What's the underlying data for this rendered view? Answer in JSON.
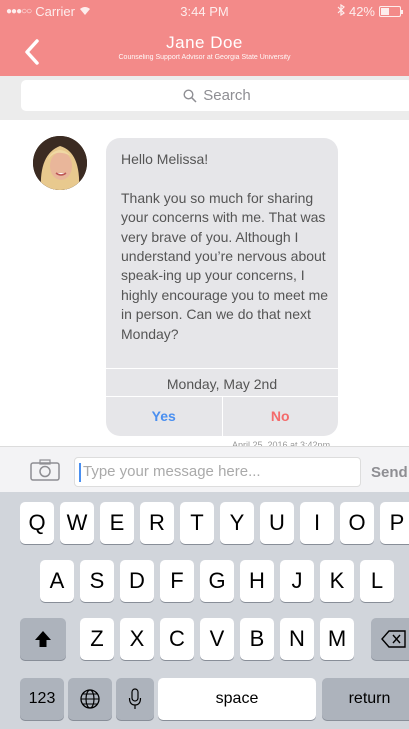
{
  "status_bar": {
    "carrier": "Carrier",
    "time": "3:44 PM",
    "battery": "42%",
    "battery_level": 0.42
  },
  "header": {
    "title": "Jane Doe",
    "subtitle": "Counseling Support Advisor at Georgia State University"
  },
  "search": {
    "placeholder": "Search"
  },
  "message": {
    "text": "Hello Melissa!\n\nThank you so much for sharing your concerns with me. That was very brave of you. Although I understand you’re nervous about speak-ing up your concerns, I highly encourage you to meet me in person. Can we do that next Monday?",
    "proposed_date": "Monday, May 2nd",
    "yes_label": "Yes",
    "no_label": "No",
    "timestamp": "April 25, 2016 at 3:42pm"
  },
  "composer": {
    "placeholder": "Type your message here...",
    "send_label": "Send"
  },
  "keyboard": {
    "row1": [
      "Q",
      "W",
      "E",
      "R",
      "T",
      "Y",
      "U",
      "I",
      "O",
      "P"
    ],
    "row2": [
      "A",
      "S",
      "D",
      "F",
      "G",
      "H",
      "J",
      "K",
      "L"
    ],
    "row3": [
      "Z",
      "X",
      "C",
      "V",
      "B",
      "N",
      "M"
    ],
    "numbers_label": "123",
    "space_label": "space",
    "return_label": "return"
  },
  "colors": {
    "header": "#f38a89",
    "yes": "#4a8ff0",
    "no": "#f46b6b"
  }
}
